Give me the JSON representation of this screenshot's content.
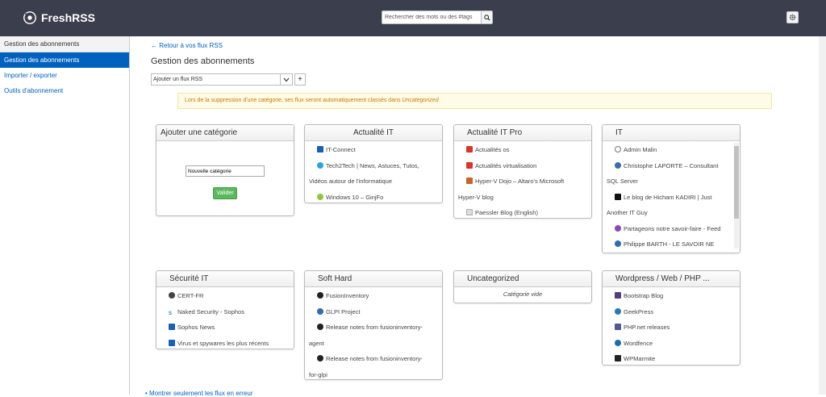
{
  "header": {
    "app_name": "FreshRSS",
    "search_placeholder": "Rechercher des mots ou des #tags"
  },
  "sidebar": {
    "title": "Gestion des abonnements",
    "items": [
      {
        "label": "Gestion des abonnements",
        "active": true
      },
      {
        "label": "Importer / exporter",
        "active": false
      },
      {
        "label": "Outils d'abonnement",
        "active": false
      }
    ]
  },
  "main": {
    "back_link": "← Retour à vos flux RSS",
    "title": "Gestion des abonnements",
    "add_feed_label": "Ajouter un flux RSS",
    "alert_text": "Lors de la suppression d'une catégorie, ses flux seront automatiquement classés dans",
    "alert_category": "Uncategorized",
    "bottom_link": "Montrer seulement les flux en erreur"
  },
  "add_category": {
    "title": "Ajouter une catégorie",
    "input_value": "Nouvelle catégorie",
    "button_label": "Valider"
  },
  "categories": [
    {
      "title": "Actualité IT",
      "feeds": [
        "IT-Connect",
        "Tech2Tech | News, Astuces, Tutos,",
        "Vidéos autour de l'informatique",
        "Windows 10 – GinjFo"
      ]
    },
    {
      "title": "Actualité IT Pro",
      "feeds": [
        "Actualités os",
        "Actualités virtualisation",
        "Hyper-V Dojo – Altaro's Microsoft",
        "Hyper-V blog",
        "Paessler Blog (English)"
      ]
    },
    {
      "title": "IT",
      "feeds": [
        "Admin Malin",
        "Christophe LAPORTE – Consultant",
        "SQL Server",
        "Le blog de Hicham KADIRI | Just",
        "Another IT Guy",
        "Partageons notre savoir-faire - Feed",
        "Philippe BARTH - LE SAVOIR NE"
      ]
    },
    {
      "title": "Sécurité IT",
      "feeds": [
        "CERT-FR",
        "Naked Security - Sophos",
        "Sophos News",
        "Virus et spywares les plus récents"
      ]
    },
    {
      "title": "Soft Hard",
      "feeds": [
        "FusionInventory",
        "GLPI Project",
        "Release notes from fusioninventory-",
        "agent",
        "Release notes from fusioninventory-",
        "for-glpi"
      ]
    },
    {
      "title": "Uncategorized",
      "empty_label": "Catégorie vide"
    },
    {
      "title": "Wordpress / Web / PHP ...",
      "feeds": [
        "Bootstrap Blog",
        "GeekPress",
        "PHP.net releases",
        "Wordfence",
        "WPMarmite"
      ]
    }
  ],
  "colors": {
    "header_bg": "#3b3f4d",
    "accent": "#0062be",
    "validate": "#5cb85c",
    "alert_text": "#c47a00"
  }
}
